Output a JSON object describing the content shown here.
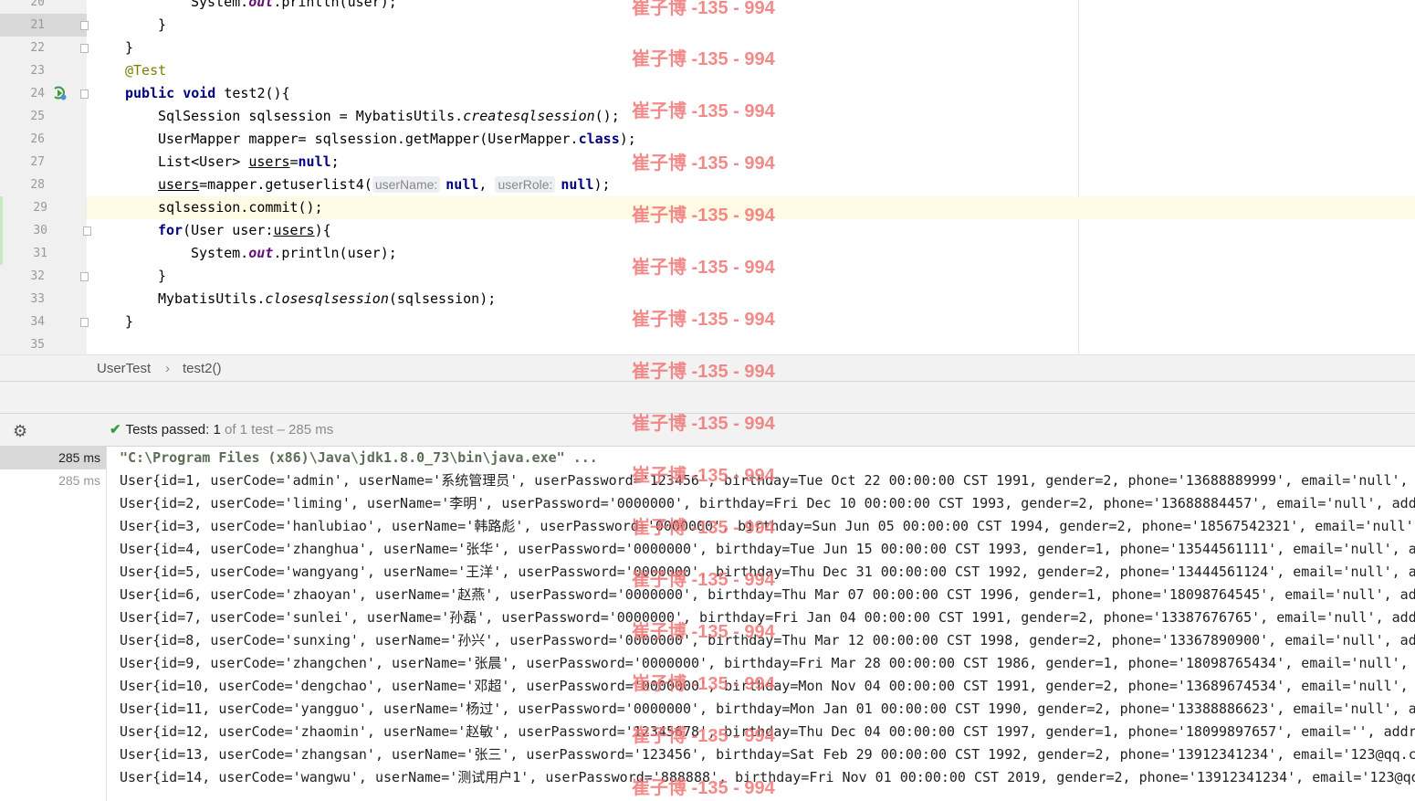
{
  "editor": {
    "line_numbers": [
      "20",
      "21",
      "22",
      "23",
      "24",
      "25",
      "26",
      "27",
      "28",
      "29",
      "30",
      "31",
      "32",
      "33",
      "34",
      "35"
    ],
    "lines": {
      "l20": "System.out.println(user);",
      "l21": "}",
      "l22": "}",
      "l23_annotation": "@Test",
      "l24_kw1": "public",
      "l24_kw2": "void",
      "l24_rest": "test2(){",
      "l25_a": "SqlSession sqlsession = MybatisUtils.",
      "l25_b": "createsqlsession",
      "l25_c": "();",
      "l26_a": "UserMapper mapper= sqlsession.getMapper(UserMapper.",
      "l26_kw": "class",
      "l26_c": ");",
      "l27_a": "List<User> ",
      "l27_var": "users",
      "l27_b": "=",
      "l27_kw": "null",
      "l27_c": ";",
      "l28_var": "users",
      "l28_a": "=mapper.getuserlist4(",
      "l28_hint1": "userName:",
      "l28_null1": "null",
      "l28_sep": ", ",
      "l28_hint2": "userRole:",
      "l28_null2": "null",
      "l28_c": ");",
      "l29": "sqlsession.commit();",
      "l30_kw": "for",
      "l30_a": "(User user:",
      "l30_var": "users",
      "l30_b": "){",
      "l31_a": "System.",
      "l31_fld": "out",
      "l31_b": ".println(user);",
      "l32": "}",
      "l33_a": "MybatisUtils.",
      "l33_b": "closesqlsession",
      "l33_c": "(sqlsession);",
      "l34": "}",
      "l20_a": "System.",
      "l20_fld": "out",
      "l20_b": ".println(user);"
    }
  },
  "breadcrumb": {
    "class_name": "UserTest",
    "separator": "›",
    "method_name": "test2()"
  },
  "test_toolbar": {
    "gear_icon": "⚙",
    "check_icon": "✔",
    "status_prefix": "Tests passed: ",
    "passed_count": "1",
    "status_suffix": " of 1 test – 285 ms"
  },
  "console": {
    "times": [
      "285 ms",
      "285 ms"
    ],
    "command": "\"C:\\Program Files (x86)\\Java\\jdk1.8.0_73\\bin\\java.exe\" ...",
    "output": [
      "User{id=1, userCode='admin', userName='系统管理员', userPassword='123456', birthday=Tue Oct 22 00:00:00 CST 1991, gender=2, phone='13688889999', email='null', address='",
      "User{id=2, userCode='liming', userName='李明', userPassword='0000000', birthday=Fri Dec 10 00:00:00 CST 1993, gender=2, phone='13688884457', email='null', address='",
      "User{id=3, userCode='hanlubiao', userName='韩路彪', userPassword='0000000', birthday=Sun Jun 05 00:00:00 CST 1994, gender=2, phone='18567542321', email='null', add",
      "User{id=4, userCode='zhanghua', userName='张华', userPassword='0000000', birthday=Tue Jun 15 00:00:00 CST 1993, gender=1, phone='13544561111', email='null', addres",
      "User{id=5, userCode='wangyang', userName='王洋', userPassword='0000000', birthday=Thu Dec 31 00:00:00 CST 1992, gender=2, phone='13444561124', email='null', addres",
      "User{id=6, userCode='zhaoyan', userName='赵燕', userPassword='0000000', birthday=Thu Mar 07 00:00:00 CST 1996, gender=1, phone='18098764545', email='null', address",
      "User{id=7, userCode='sunlei', userName='孙磊', userPassword='0000000', birthday=Fri Jan 04 00:00:00 CST 1991, gender=2, phone='13387676765', email='null', address=",
      "User{id=8, userCode='sunxing', userName='孙兴', userPassword='0000000', birthday=Thu Mar 12 00:00:00 CST 1998, gender=2, phone='13367890900', email='null', address",
      "User{id=9, userCode='zhangchen', userName='张晨', userPassword='0000000', birthday=Fri Mar 28 00:00:00 CST 1986, gender=1, phone='18098765434', email='null', addre",
      "User{id=10, userCode='dengchao', userName='邓超', userPassword='0000000', birthday=Mon Nov 04 00:00:00 CST 1991, gender=2, phone='13689674534', email='null', addre",
      "User{id=11, userCode='yangguo', userName='杨过', userPassword='0000000', birthday=Mon Jan 01 00:00:00 CST 1990, gender=2, phone='13388886623', email='null', addres",
      "User{id=12, userCode='zhaomin', userName='赵敏', userPassword='12345678', birthday=Thu Dec 04 00:00:00 CST 1997, gender=1, phone='18099897657', email='', address='",
      "User{id=13, userCode='zhangsan', userName='张三', userPassword='123456', birthday=Sat Feb 29 00:00:00 CST 1992, gender=2, phone='13912341234', email='123@qq.com',",
      "User{id=14, userCode='wangwu', userName='测试用户1', userPassword='888888', birthday=Fri Nov 01 00:00:00 CST 2019, gender=2, phone='13912341234', email='123@qq.com'"
    ]
  },
  "watermark": "崔子博 -135 - 994"
}
